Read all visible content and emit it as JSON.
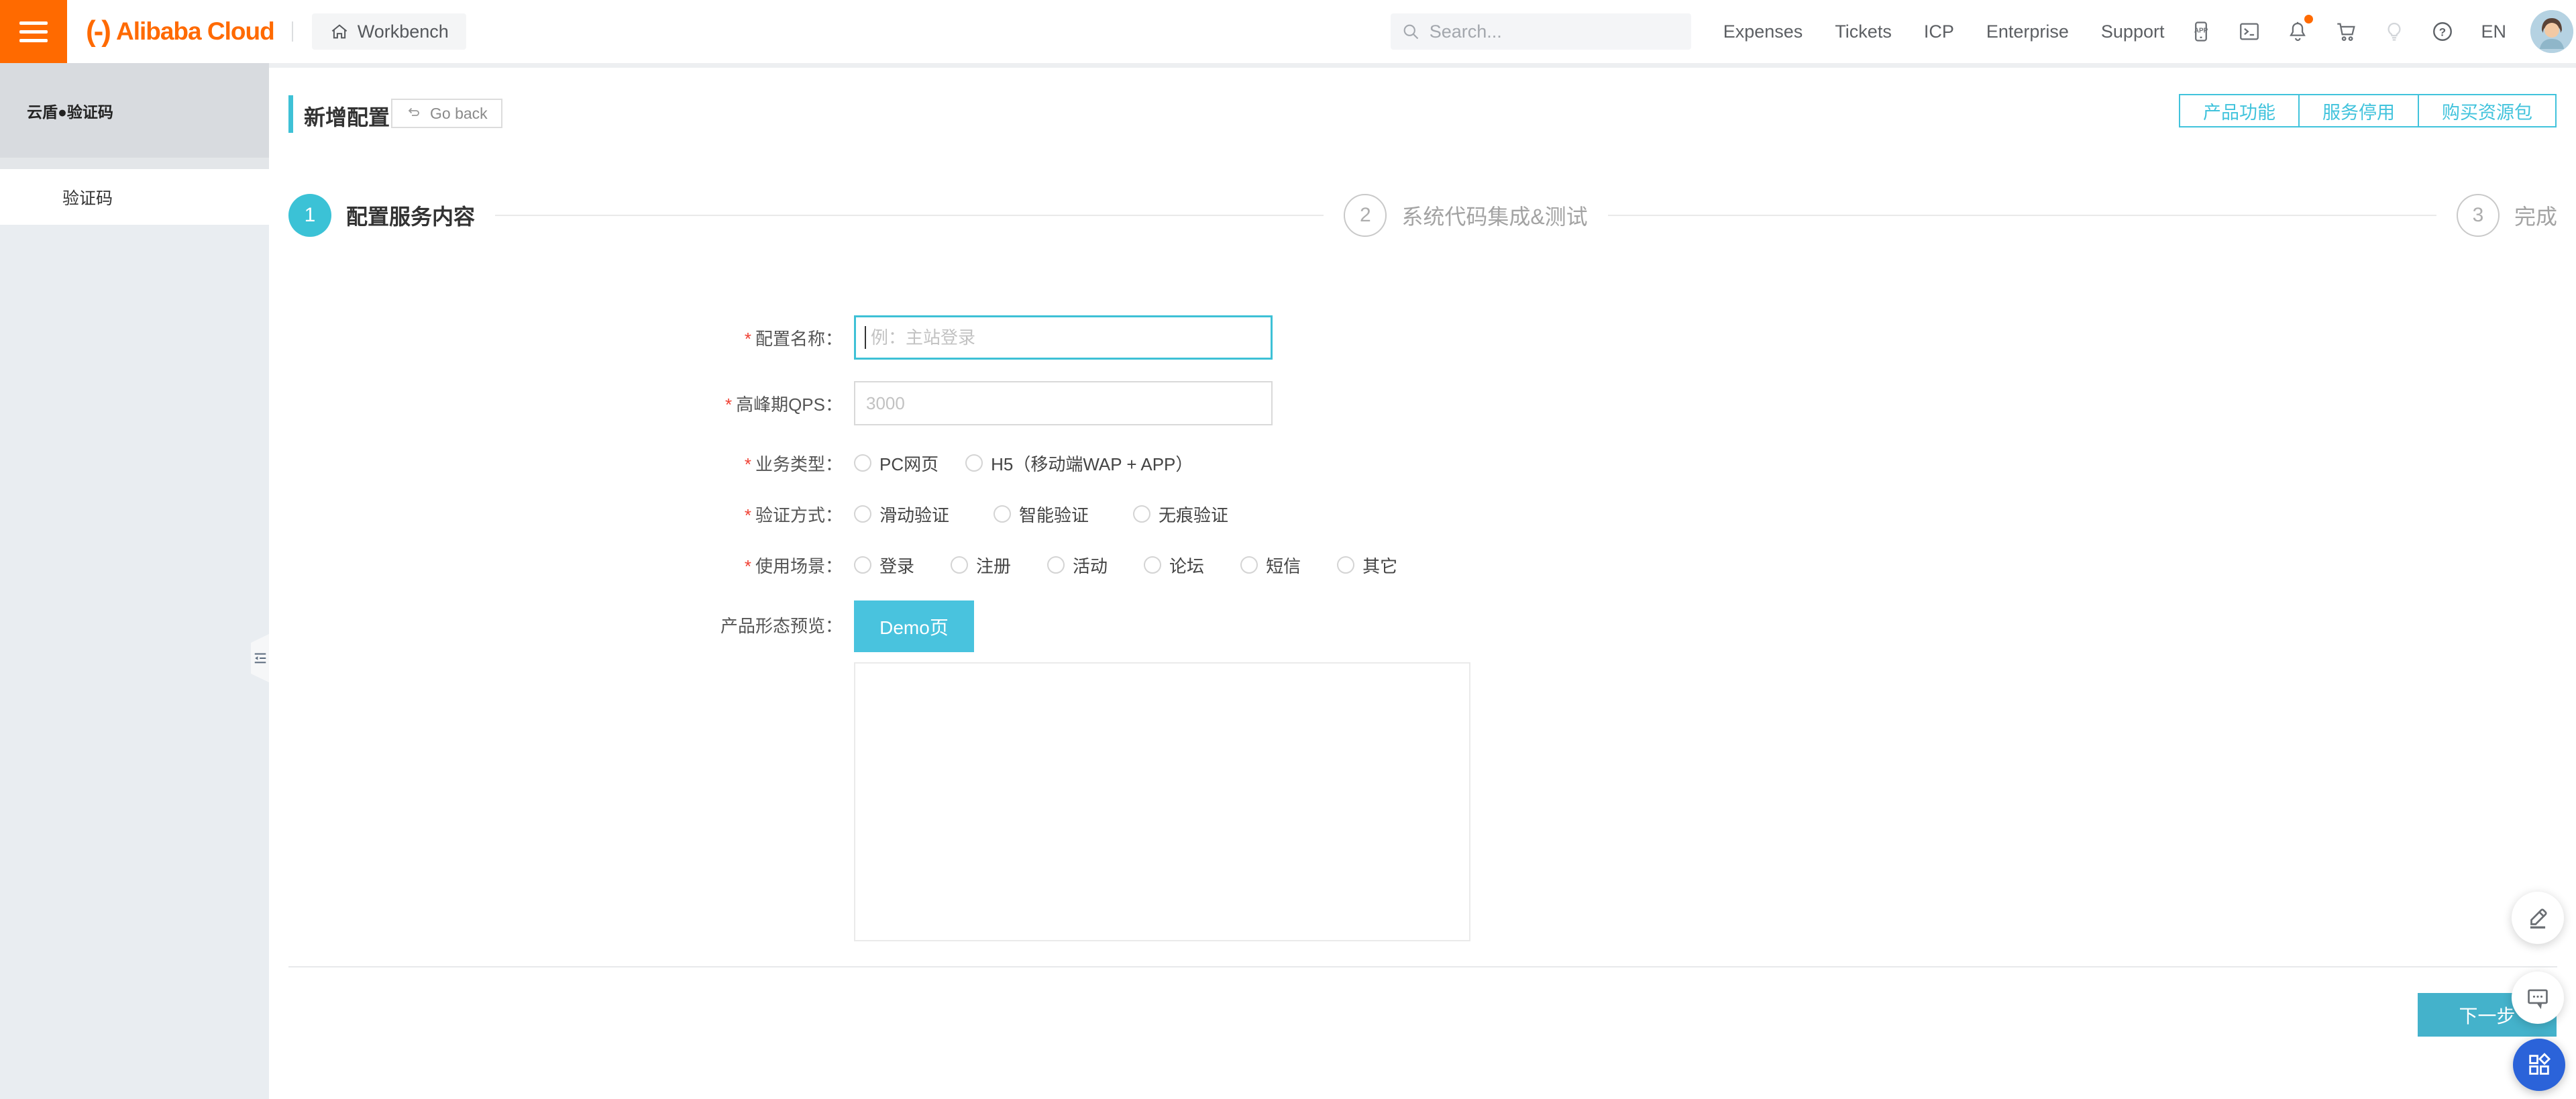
{
  "navbar": {
    "brand": "Alibaba Cloud",
    "workbench_label": "Workbench",
    "search_placeholder": "Search...",
    "links": [
      "Expenses",
      "Tickets",
      "ICP",
      "Enterprise",
      "Support"
    ],
    "icons": [
      "hamburger-icon",
      "home-icon",
      "search-icon",
      "app-download-icon",
      "terminal-icon",
      "bell-icon",
      "cart-icon",
      "bulb-icon",
      "help-icon",
      "avatar"
    ],
    "language": "EN"
  },
  "sidebar": {
    "header": "云盾●验证码",
    "items": [
      {
        "label": "验证码"
      }
    ],
    "collapse_icon": "menu-fold-icon"
  },
  "page_header": {
    "title": "新增配置",
    "go_back": "Go back",
    "actions": [
      "产品功能",
      "服务停用",
      "购买资源包"
    ]
  },
  "steps": [
    {
      "num": "1",
      "label": "配置服务内容",
      "active": true
    },
    {
      "num": "2",
      "label": "系统代码集成&测试",
      "active": false
    },
    {
      "num": "3",
      "label": "完成",
      "active": false
    }
  ],
  "form": {
    "config_name": {
      "label": "配置名称：",
      "required": true,
      "value": "",
      "placeholder": "例：主站登录",
      "focused": true
    },
    "peak_qps": {
      "label": "高峰期QPS：",
      "required": true,
      "value": "",
      "placeholder": "3000"
    },
    "business_type": {
      "label": "业务类型：",
      "required": true,
      "selected": null,
      "options": [
        "PC网页",
        "H5（移动端WAP + APP）"
      ]
    },
    "verify_method": {
      "label": "验证方式：",
      "required": true,
      "selected": null,
      "options": [
        "滑动验证",
        "智能验证",
        "无痕验证"
      ]
    },
    "usage_scene": {
      "label": "使用场景：",
      "required": true,
      "selected": null,
      "options": [
        "登录",
        "注册",
        "活动",
        "论坛",
        "短信",
        "其它"
      ]
    },
    "preview": {
      "label": "产品形态预览：",
      "demo_button": "Demo页"
    }
  },
  "footer": {
    "next_button": "下一步"
  },
  "floating": {
    "icons": [
      "pencil-icon",
      "chat-icon",
      "app-grid-icon"
    ]
  },
  "colors": {
    "brand_orange": "#ff6a00",
    "accent_teal": "#3ec1d6",
    "next_button_teal": "#44b2cb",
    "fab_blue": "#2b63d9",
    "required_red": "#f04134",
    "sidebar_header_bg": "#d8dbdf",
    "sidebar_bg": "#e9edf1"
  }
}
